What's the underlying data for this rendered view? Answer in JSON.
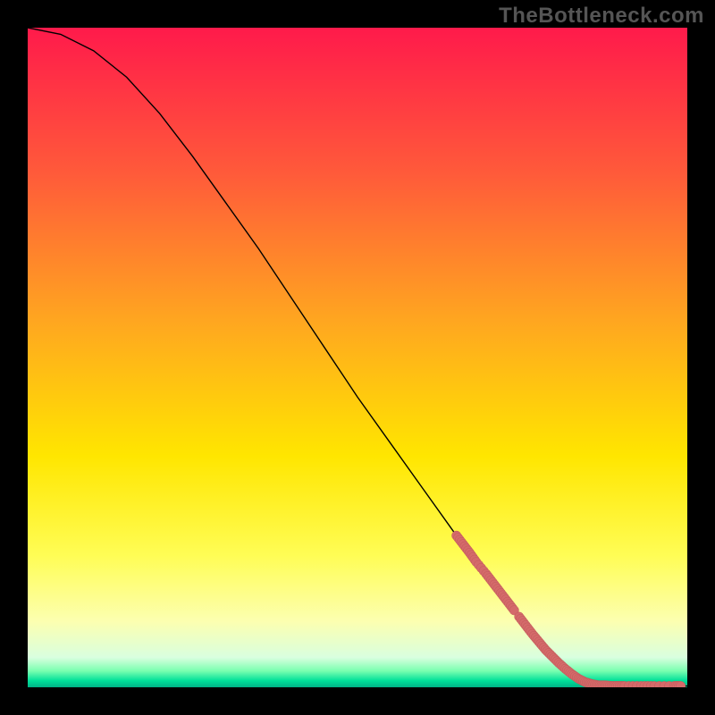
{
  "watermark": "TheBottleneck.com",
  "colors": {
    "marker": "#d46a6a",
    "curve": "#000000",
    "gradient_stops": [
      {
        "offset": 0,
        "color": "#ff1a4b"
      },
      {
        "offset": 0.22,
        "color": "#ff5a3a"
      },
      {
        "offset": 0.45,
        "color": "#ffa81f"
      },
      {
        "offset": 0.65,
        "color": "#ffe600"
      },
      {
        "offset": 0.8,
        "color": "#fffd55"
      },
      {
        "offset": 0.9,
        "color": "#fcffb0"
      },
      {
        "offset": 0.955,
        "color": "#d9ffdf"
      },
      {
        "offset": 0.975,
        "color": "#7affb0"
      },
      {
        "offset": 0.99,
        "color": "#00e099"
      },
      {
        "offset": 1.0,
        "color": "#00b386"
      }
    ]
  },
  "chart_data": {
    "type": "line",
    "title": "",
    "xlabel": "",
    "ylabel": "",
    "xlim": [
      0,
      100
    ],
    "ylim": [
      0,
      100
    ],
    "series": [
      {
        "name": "curve",
        "style": "line",
        "points": [
          {
            "x": 0,
            "y": 100
          },
          {
            "x": 5,
            "y": 99
          },
          {
            "x": 10,
            "y": 96.5
          },
          {
            "x": 15,
            "y": 92.5
          },
          {
            "x": 20,
            "y": 87
          },
          {
            "x": 25,
            "y": 80.5
          },
          {
            "x": 30,
            "y": 73.5
          },
          {
            "x": 35,
            "y": 66.5
          },
          {
            "x": 40,
            "y": 59
          },
          {
            "x": 45,
            "y": 51.5
          },
          {
            "x": 50,
            "y": 44
          },
          {
            "x": 55,
            "y": 37
          },
          {
            "x": 60,
            "y": 30
          },
          {
            "x": 65,
            "y": 23
          },
          {
            "x": 70,
            "y": 16.5
          },
          {
            "x": 75,
            "y": 10
          },
          {
            "x": 80,
            "y": 4.5
          },
          {
            "x": 83,
            "y": 1.5
          },
          {
            "x": 85,
            "y": 0.5
          },
          {
            "x": 88,
            "y": 0.2
          },
          {
            "x": 92,
            "y": 0.2
          },
          {
            "x": 96,
            "y": 0.2
          },
          {
            "x": 100,
            "y": 0.2
          }
        ]
      },
      {
        "name": "highlighted-segment",
        "style": "thick-marker-line",
        "points": [
          {
            "x": 65,
            "y": 23
          },
          {
            "x": 66,
            "y": 21.7
          },
          {
            "x": 67,
            "y": 20.4
          },
          {
            "x": 68,
            "y": 19.0
          },
          {
            "x": 69.5,
            "y": 17.2
          },
          {
            "x": 70.5,
            "y": 15.9
          },
          {
            "x": 71.5,
            "y": 14.6
          },
          {
            "x": 72.5,
            "y": 13.3
          },
          {
            "x": 73.5,
            "y": 12.0
          },
          {
            "x": 74.5,
            "y": 10.7
          },
          {
            "x": 75.5,
            "y": 9.4
          },
          {
            "x": 76.5,
            "y": 8.1
          },
          {
            "x": 77.5,
            "y": 6.9
          },
          {
            "x": 78.5,
            "y": 5.7
          },
          {
            "x": 79.5,
            "y": 4.7
          },
          {
            "x": 80.5,
            "y": 3.7
          },
          {
            "x": 81.5,
            "y": 2.8
          },
          {
            "x": 82.5,
            "y": 2.0
          },
          {
            "x": 83.5,
            "y": 1.3
          },
          {
            "x": 84.5,
            "y": 0.8
          },
          {
            "x": 85.5,
            "y": 0.5
          },
          {
            "x": 86.5,
            "y": 0.3
          },
          {
            "x": 87.5,
            "y": 0.3
          },
          {
            "x": 88.5,
            "y": 0.2
          },
          {
            "x": 89.5,
            "y": 0.2
          },
          {
            "x": 90.5,
            "y": 0.2
          },
          {
            "x": 93.0,
            "y": 0.2
          },
          {
            "x": 95.0,
            "y": 0.2
          },
          {
            "x": 98.0,
            "y": 0.2
          },
          {
            "x": 99.0,
            "y": 0.2
          }
        ]
      }
    ]
  }
}
